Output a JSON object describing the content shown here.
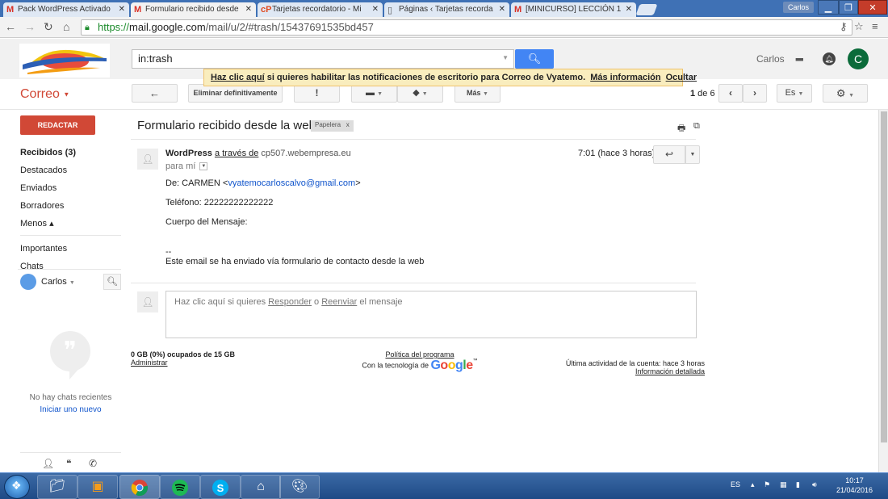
{
  "browser": {
    "tabs": [
      {
        "label": "Pack WordPress Activado",
        "icon": "gmail-icon"
      },
      {
        "label": "Formulario recibido desde",
        "icon": "gmail-icon",
        "active": true
      },
      {
        "label": "Tarjetas recordatorio - Mi",
        "icon": "cp-icon"
      },
      {
        "label": "Páginas ‹ Tarjetas recorda",
        "icon": "page-icon"
      },
      {
        "label": "[MINICURSO] LECCIÓN 1",
        "icon": "gmail-icon"
      }
    ],
    "window_user": "Carlos",
    "url_scheme": "https://",
    "url_host": "mail.google.com",
    "url_path": "/mail/u/2/#trash/15437691535bd457"
  },
  "header": {
    "search_value": "in:trash",
    "user_name": "Carlos",
    "avatar_letter": "C"
  },
  "notification": {
    "link": "Haz clic aquí",
    "text": " si quieres habilitar las notificaciones de escritorio para Correo de Vyatemo.",
    "more_info": "Más información",
    "hide": "Ocultar"
  },
  "toolbar": {
    "app_label": "Correo",
    "back_glyph": "←",
    "delete_forever": "Eliminar definitivamente",
    "spam_glyph": "!",
    "folder_glyph": "▬",
    "label_glyph": "◆",
    "more": "Más",
    "pager_range": "1",
    "pager_of": " de 6",
    "lang": "Es",
    "settings_glyph": "⚙"
  },
  "sidebar": {
    "compose": "REDACTAR",
    "items": [
      {
        "label": "Recibidos (3)",
        "bold": true
      },
      {
        "label": "Destacados"
      },
      {
        "label": "Enviados"
      },
      {
        "label": "Borradores"
      },
      {
        "label": "Menos ▴"
      }
    ],
    "extra_items": [
      "Importantes",
      "Chats"
    ],
    "chat_user": "Carlos",
    "no_chats": "No hay chats recientes",
    "start_new": "Iniciar uno nuevo"
  },
  "message": {
    "subject": "Formulario recibido desde la web",
    "label": "Papelera",
    "label_x": "x",
    "sender_name": "WordPress",
    "via": "a través de",
    "via_domain": "cp507.webempresa.eu",
    "to": "para mí",
    "time": "7:01 (hace 3 horas)",
    "from_line_prefix": "De: CARMEN <",
    "from_email": "vyatemocarloscalvo@gmail.com",
    "from_line_suffix": ">",
    "phone": "Teléfono: 22222222222222",
    "body_label": "Cuerpo del Mensaje:",
    "signature_dash": "--",
    "footer_note": "Este email se ha enviado vía formulario de contacto desde la web"
  },
  "reply": {
    "prefix": "Haz clic aquí si quieres ",
    "reply_link": "Responder",
    "middle": " o ",
    "forward_link": "Reenviar",
    "suffix": " el mensaje"
  },
  "footer": {
    "storage": "0 GB (0%) ocupados de 15 GB",
    "manage": "Administrar",
    "policy": "Política del programa",
    "powered": "Con la tecnología de ",
    "google": "Google",
    "last_activity": "Última actividad de la cuenta: hace 3 horas",
    "details": "Información detallada"
  },
  "taskbar": {
    "lang": "ES",
    "time": "10:17",
    "date": "21/04/2016"
  }
}
